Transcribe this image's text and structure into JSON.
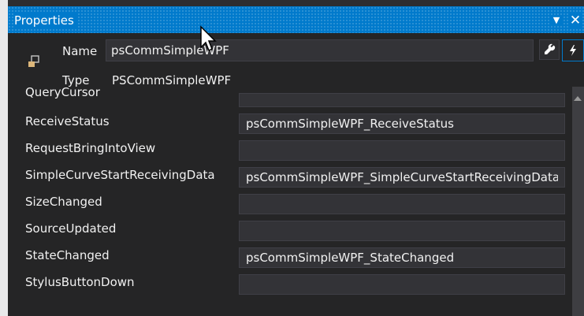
{
  "panel": {
    "title": "Properties",
    "dropdown_icon": "▼",
    "close_icon": "✕"
  },
  "header": {
    "name_label": "Name",
    "name_value": "psCommSimpleWPF",
    "type_label": "Type",
    "type_value": "PSCommSimpleWPF"
  },
  "events": [
    {
      "name": "QueryCursor",
      "value": ""
    },
    {
      "name": "ReceiveStatus",
      "value": "psCommSimpleWPF_ReceiveStatus"
    },
    {
      "name": "RequestBringIntoView",
      "value": ""
    },
    {
      "name": "SimpleCurveStartReceivingData",
      "value": "psCommSimpleWPF_SimpleCurveStartReceivingData"
    },
    {
      "name": "SizeChanged",
      "value": ""
    },
    {
      "name": "SourceUpdated",
      "value": ""
    },
    {
      "name": "StateChanged",
      "value": "psCommSimpleWPF_StateChanged"
    },
    {
      "name": "StylusButtonDown",
      "value": ""
    }
  ],
  "colors": {
    "accent": "#007acc",
    "panel_bg": "#252526",
    "field_bg": "#333337",
    "text": "#f1f1f1"
  }
}
